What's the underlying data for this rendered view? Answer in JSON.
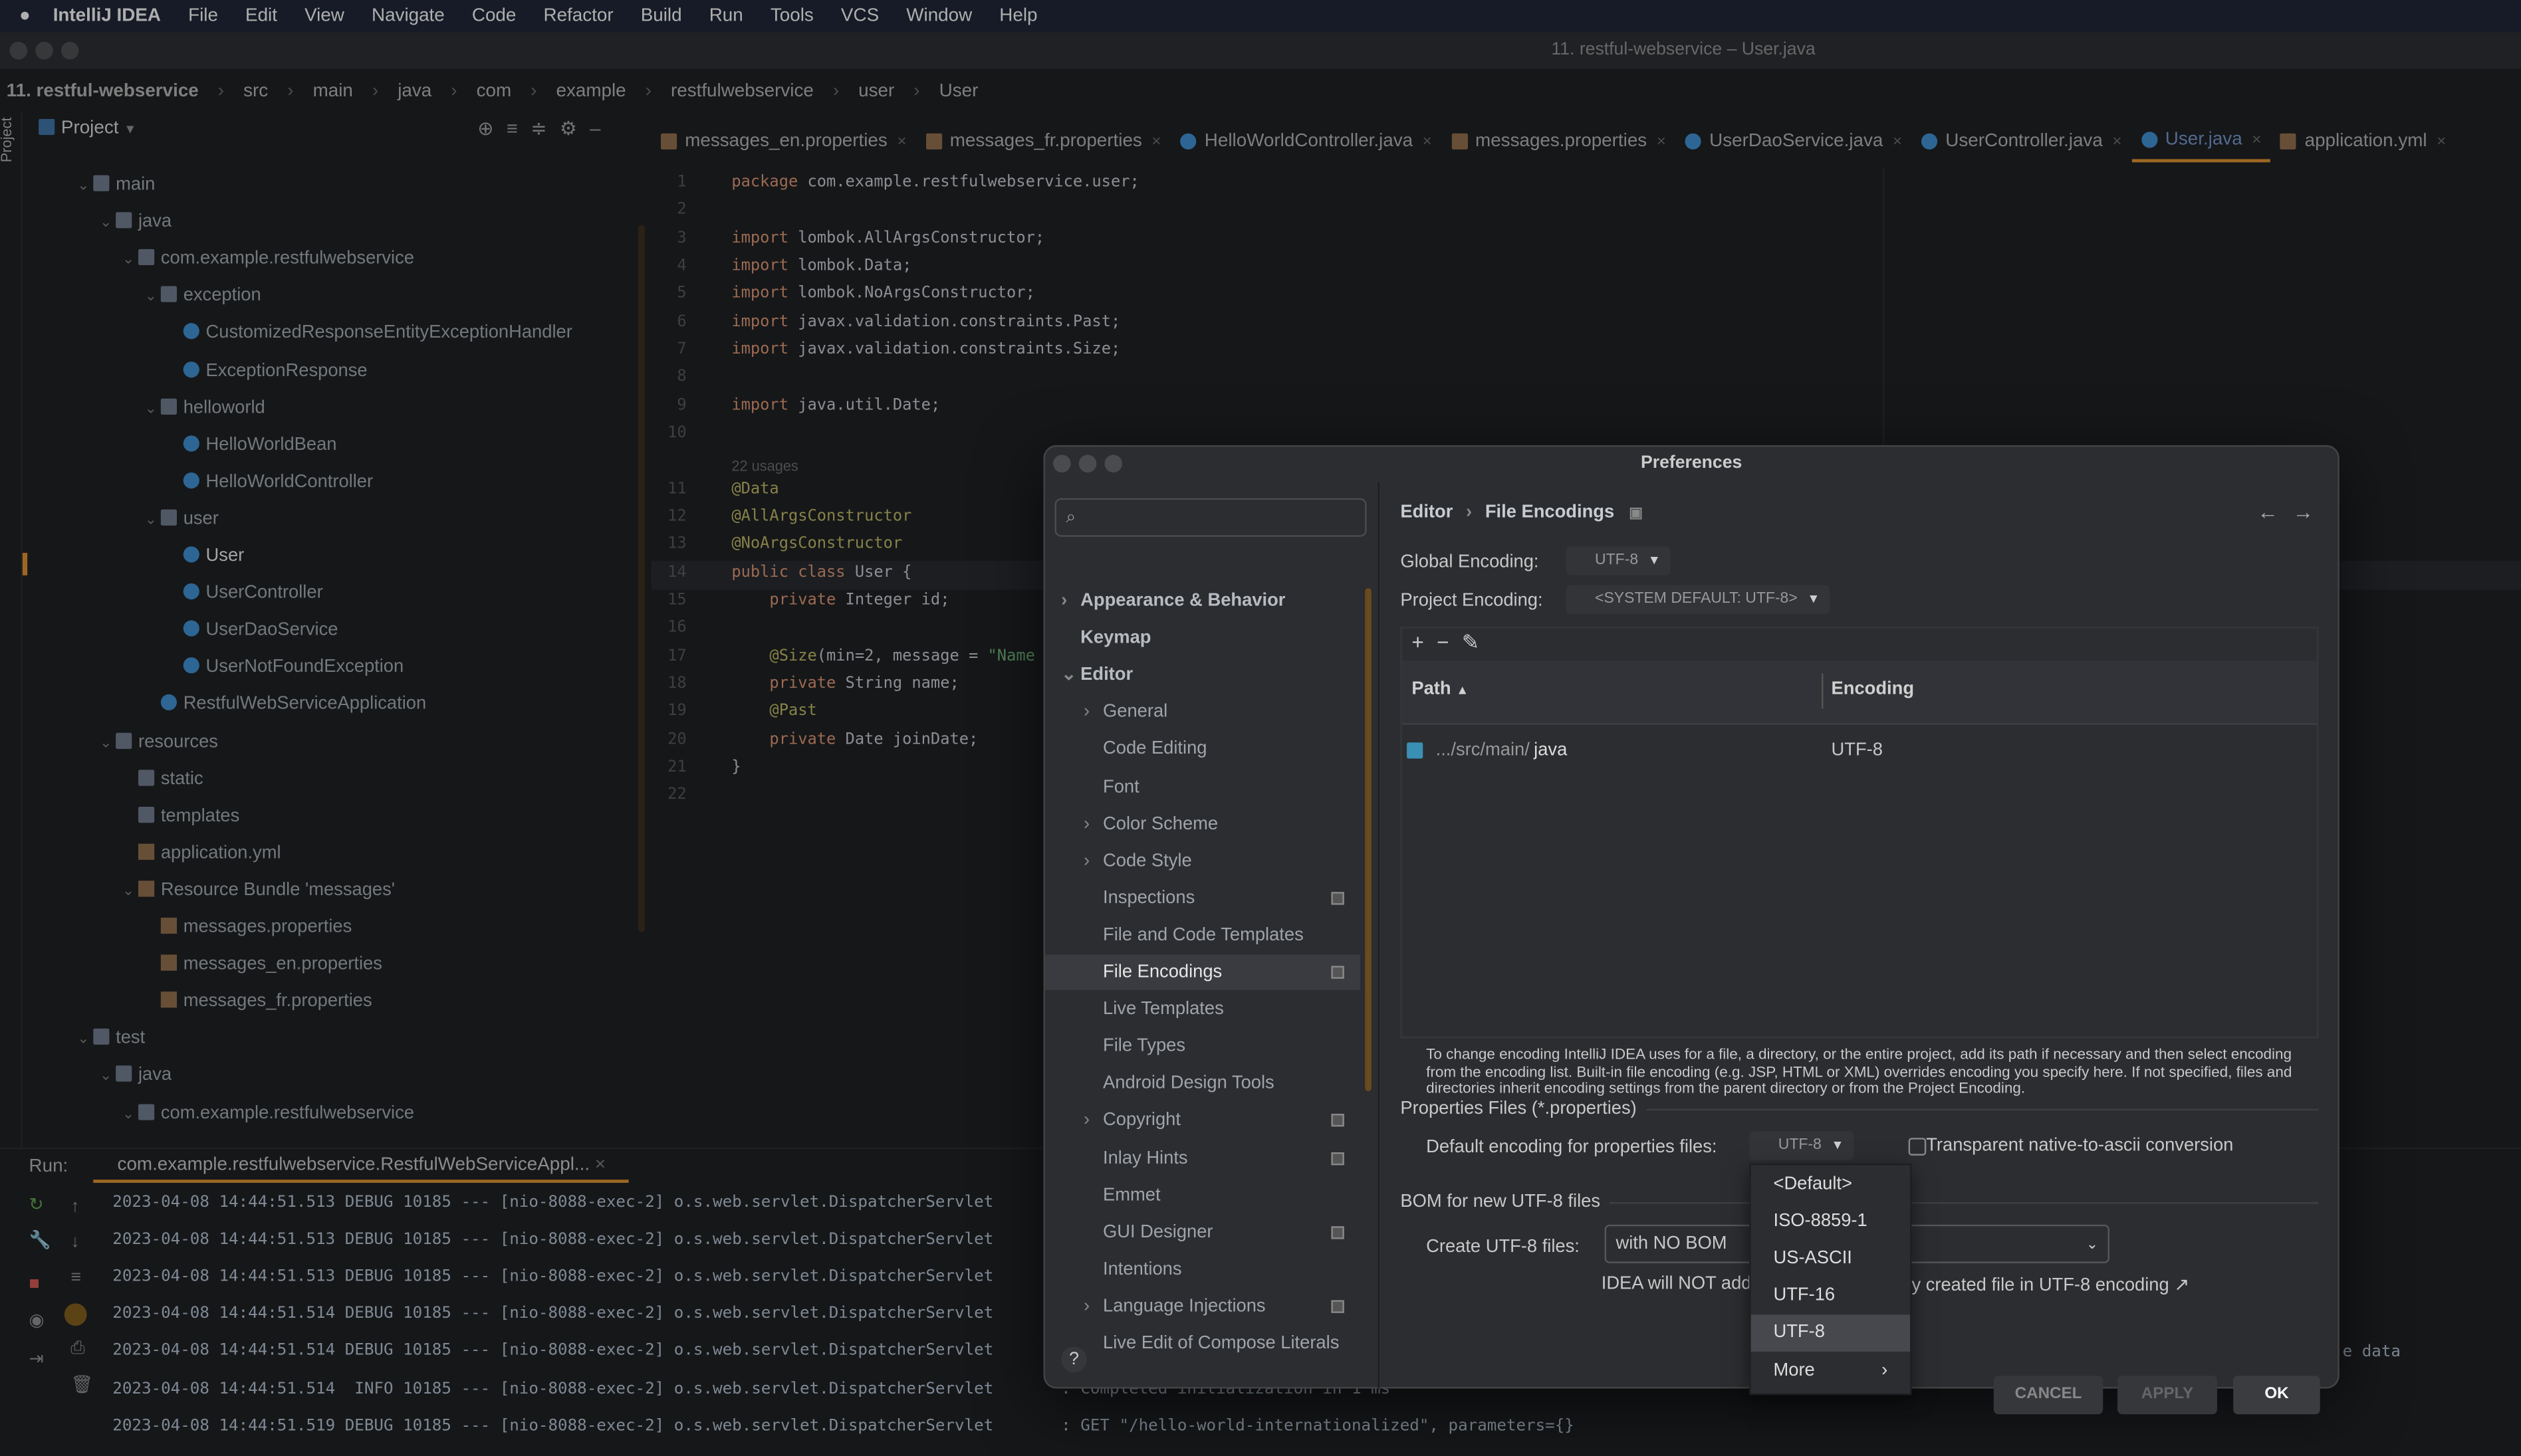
{
  "menubar": {
    "apple": "",
    "app": "IntelliJ IDEA",
    "items": [
      "File",
      "Edit",
      "View",
      "Navigate",
      "Code",
      "Refactor",
      "Build",
      "Run",
      "Tools",
      "VCS",
      "Window",
      "Help"
    ]
  },
  "window": {
    "title": "11. restful-webservice – User.java"
  },
  "breadcrumb": [
    "11. restful-webservice",
    "src",
    "main",
    "java",
    "com",
    "example",
    "restfulwebservice",
    "user",
    "User"
  ],
  "project": {
    "label": "Project",
    "tree": [
      {
        "t": "main",
        "k": "fold",
        "d": 1,
        "c": "v"
      },
      {
        "t": "java",
        "k": "fold",
        "d": 2,
        "c": "v"
      },
      {
        "t": "com.example.restfulwebservice",
        "k": "fold",
        "d": 3,
        "c": "v"
      },
      {
        "t": "exception",
        "k": "fold",
        "d": 4,
        "c": "v"
      },
      {
        "t": "CustomizedResponseEntityExceptionHandler",
        "k": "cls",
        "d": 5
      },
      {
        "t": "ExceptionResponse",
        "k": "cls",
        "d": 5
      },
      {
        "t": "helloworld",
        "k": "fold",
        "d": 4,
        "c": "v"
      },
      {
        "t": "HelloWorldBean",
        "k": "cls",
        "d": 5
      },
      {
        "t": "HelloWorldController",
        "k": "cls",
        "d": 5
      },
      {
        "t": "user",
        "k": "fold",
        "d": 4,
        "c": "v"
      },
      {
        "t": "User",
        "k": "cls",
        "d": 5,
        "sel": true
      },
      {
        "t": "UserController",
        "k": "cls",
        "d": 5
      },
      {
        "t": "UserDaoService",
        "k": "cls",
        "d": 5
      },
      {
        "t": "UserNotFoundException",
        "k": "cls",
        "d": 5
      },
      {
        "t": "RestfulWebServiceApplication",
        "k": "cls",
        "d": 4
      },
      {
        "t": "resources",
        "k": "fold",
        "d": 2,
        "c": "v"
      },
      {
        "t": "static",
        "k": "fold",
        "d": 3
      },
      {
        "t": "templates",
        "k": "fold",
        "d": 3
      },
      {
        "t": "application.yml",
        "k": "prop",
        "d": 3
      },
      {
        "t": "Resource Bundle 'messages'",
        "k": "prop",
        "d": 3,
        "c": "v"
      },
      {
        "t": "messages.properties",
        "k": "prop",
        "d": 4
      },
      {
        "t": "messages_en.properties",
        "k": "prop",
        "d": 4
      },
      {
        "t": "messages_fr.properties",
        "k": "prop",
        "d": 4
      },
      {
        "t": "test",
        "k": "fold",
        "d": 1,
        "c": "v"
      },
      {
        "t": "java",
        "k": "fold",
        "d": 2,
        "c": "v"
      },
      {
        "t": "com.example.restfulwebservice",
        "k": "fold",
        "d": 3,
        "c": "v"
      }
    ]
  },
  "tabs": [
    {
      "label": "messages_en.properties",
      "p": true
    },
    {
      "label": "messages_fr.properties",
      "p": true
    },
    {
      "label": "HelloWorldController.java"
    },
    {
      "label": "messages.properties",
      "p": true
    },
    {
      "label": "UserDaoService.java"
    },
    {
      "label": "UserController.java"
    },
    {
      "label": "User.java",
      "active": true
    },
    {
      "label": "application.yml",
      "p": true
    }
  ],
  "code": {
    "usages": "22 usages",
    "lines": [
      [
        [
          "kw",
          "package "
        ],
        [
          "pk",
          "com.example.restfulwebservice.user;"
        ]
      ],
      [],
      [
        [
          "kw",
          "import "
        ],
        [
          "pk",
          "lombok.AllArgsConstructor;"
        ]
      ],
      [
        [
          "kw",
          "import "
        ],
        [
          "pk",
          "lombok.Data;"
        ]
      ],
      [
        [
          "kw",
          "import "
        ],
        [
          "pk",
          "lombok.NoArgsConstructor;"
        ]
      ],
      [
        [
          "kw",
          "import "
        ],
        [
          "pk",
          "javax.validation.constraints.Past;"
        ]
      ],
      [
        [
          "kw",
          "import "
        ],
        [
          "pk",
          "javax.validation.constraints.Size;"
        ]
      ],
      [],
      [
        [
          "kw",
          "import "
        ],
        [
          "pk",
          "java.util.Date;"
        ]
      ],
      [],
      [
        [
          "an",
          "@Data"
        ]
      ],
      [
        [
          "an",
          "@AllArgsConstructor"
        ]
      ],
      [
        [
          "an",
          "@NoArgsConstructor"
        ]
      ],
      [
        [
          "kw",
          "public class "
        ],
        [
          "pk",
          "User {"
        ]
      ],
      [
        [
          "kw",
          "    private "
        ],
        [
          "pk",
          "Integer id;"
        ]
      ],
      [],
      [
        [
          "an",
          "    @Size"
        ],
        [
          "pk",
          "(min=2, message = "
        ],
        [
          "st",
          "\"Name"
        ]
      ],
      [
        [
          "kw",
          "    private "
        ],
        [
          "pk",
          "String name;"
        ]
      ],
      [
        [
          "an",
          "    @Past"
        ]
      ],
      [
        [
          "kw",
          "    private "
        ],
        [
          "pk",
          "Date joinDate;"
        ]
      ],
      [
        [
          "pk",
          "}"
        ]
      ],
      []
    ]
  },
  "run": {
    "label": "Run:",
    "config": "com.example.restfulwebservice.RestfulWebServiceAppl...",
    "logs": [
      "2023-04-08 14:44:51.513 DEBUG 10185 --- [nio-8088-exec-2] o.s.web.servlet.DispatcherServlet",
      "2023-04-08 14:44:51.513 DEBUG 10185 --- [nio-8088-exec-2] o.s.web.servlet.DispatcherServlet",
      "2023-04-08 14:44:51.513 DEBUG 10185 --- [nio-8088-exec-2] o.s.web.servlet.DispatcherServlet",
      "2023-04-08 14:44:51.514 DEBUG 10185 --- [nio-8088-exec-2] o.s.web.servlet.DispatcherServlet",
      "2023-04-08 14:44:51.514 DEBUG 10185 --- [nio-8088-exec-2] o.s.web.servlet.DispatcherServlet",
      "2023-04-08 14:44:51.514  INFO 10185 --- [nio-8088-exec-2] o.s.web.servlet.DispatcherServlet",
      "2023-04-08 14:44:51.519 DEBUG 10185 --- [nio-8088-exec-2] o.s.web.servlet.DispatcherServlet"
    ],
    "tail_right": "e data",
    "tail1": ": Completed initialization in 1 ms",
    "tail2": ": GET \"/hello-world-internationalized\", parameters={}"
  },
  "dialog": {
    "title": "Preferences",
    "search_placeholder": "",
    "nav": [
      {
        "t": "Appearance & Behavior",
        "d": 0,
        "c": ">",
        "top": true
      },
      {
        "t": "Keymap",
        "d": 0,
        "top": true
      },
      {
        "t": "Editor",
        "d": 0,
        "c": "v",
        "top": true
      },
      {
        "t": "General",
        "d": 1,
        "c": ">"
      },
      {
        "t": "Code Editing",
        "d": 1
      },
      {
        "t": "Font",
        "d": 1
      },
      {
        "t": "Color Scheme",
        "d": 1,
        "c": ">"
      },
      {
        "t": "Code Style",
        "d": 1,
        "c": ">"
      },
      {
        "t": "Inspections",
        "d": 1,
        "ic": true
      },
      {
        "t": "File and Code Templates",
        "d": 1
      },
      {
        "t": "File Encodings",
        "d": 1,
        "ic": true,
        "sel": true
      },
      {
        "t": "Live Templates",
        "d": 1
      },
      {
        "t": "File Types",
        "d": 1
      },
      {
        "t": "Android Design Tools",
        "d": 1
      },
      {
        "t": "Copyright",
        "d": 1,
        "c": ">",
        "ic": true
      },
      {
        "t": "Inlay Hints",
        "d": 1,
        "ic": true
      },
      {
        "t": "Emmet",
        "d": 1
      },
      {
        "t": "GUI Designer",
        "d": 1,
        "ic": true
      },
      {
        "t": "Intentions",
        "d": 1
      },
      {
        "t": "Language Injections",
        "d": 1,
        "c": ">",
        "ic": true
      },
      {
        "t": "Live Edit of Compose Literals",
        "d": 1
      }
    ],
    "crumb1": "Editor",
    "crumb2": "File Encodings",
    "global_label": "Global Encoding:",
    "global_value": "UTF-8",
    "project_label": "Project Encoding:",
    "project_value": "<SYSTEM DEFAULT: UTF-8>",
    "col_path": "Path",
    "col_encoding": "Encoding",
    "row": {
      "path_prefix": ".../src/main/",
      "path_last": "java",
      "encoding": "UTF-8"
    },
    "help": "To change encoding IntelliJ IDEA uses for a file, a directory, or the entire project, add its path if necessary and then select encoding from the encoding list. Built-in file encoding (e.g. JSP, HTML or XML) overrides encoding you specify here. If not specified, files and directories inherit encoding settings from the parent directory or from the Project Encoding.",
    "props_section": "Properties Files (*.properties)",
    "props_label": "Default encoding for properties files:",
    "props_value": "UTF-8",
    "transparent_label": "Transparent native-to-ascii conversion",
    "transparent_checked": false,
    "bom_section": "BOM for new UTF-8 files",
    "bom_label": "Create UTF-8 files:",
    "bom_value": "with NO BOM",
    "bom_note_a": "IDEA will NOT add",
    "bom_note_b": "y created file in UTF-8 encoding ↗",
    "cancel": "CANCEL",
    "apply": "APPLY",
    "ok": "OK",
    "help_btn": "?"
  },
  "popup": {
    "options": [
      "<Default>",
      "ISO-8859-1",
      "US-ASCII",
      "UTF-16",
      "UTF-8",
      "More"
    ],
    "selected": "UTF-8"
  }
}
